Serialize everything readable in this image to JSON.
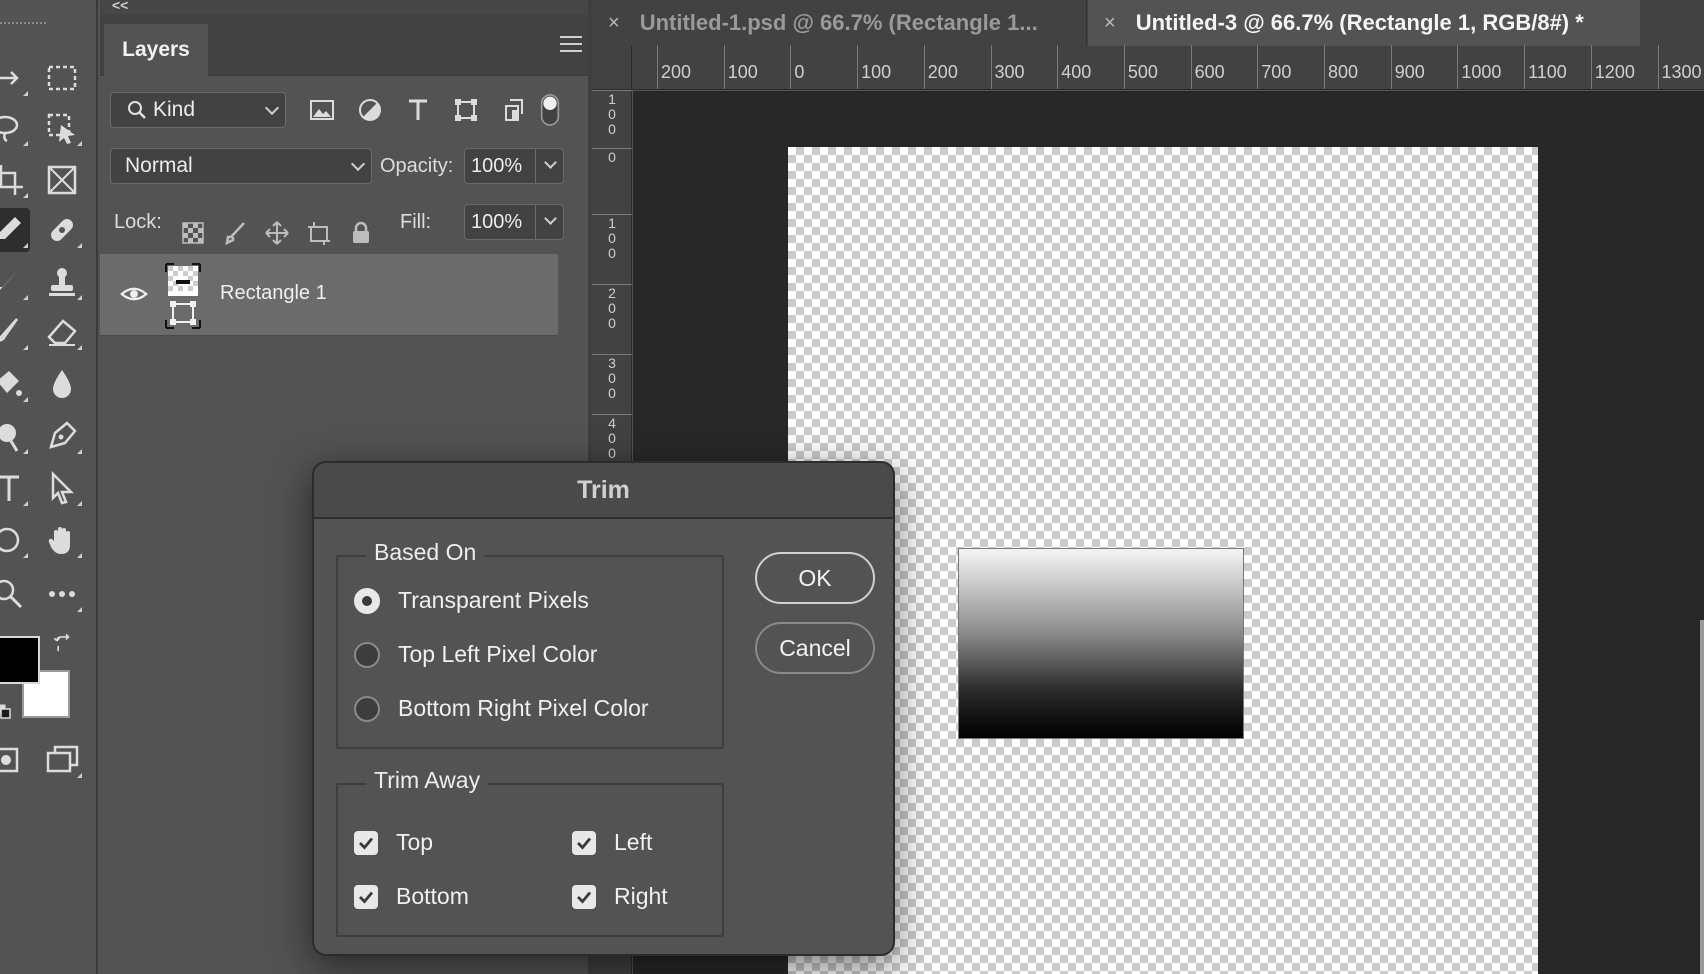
{
  "toolbar": {
    "collapse_glyph": "<<",
    "tools": [
      {
        "name": "move-tool",
        "icon": "move-icon"
      },
      {
        "name": "marquee-tool",
        "icon": "rectangular-marquee-icon"
      },
      {
        "name": "lasso-tool",
        "icon": "lasso-icon"
      },
      {
        "name": "object-selection-tool",
        "icon": "object-selection-icon"
      },
      {
        "name": "crop-tool",
        "icon": "crop-icon"
      },
      {
        "name": "frame-tool",
        "icon": "frame-icon"
      },
      {
        "name": "eyedropper-tool",
        "icon": "eyedropper-icon"
      },
      {
        "name": "healing-brush-tool",
        "icon": "bandage-icon"
      },
      {
        "name": "brush-tool",
        "icon": "brush-icon"
      },
      {
        "name": "clone-stamp-tool",
        "icon": "stamp-icon"
      },
      {
        "name": "history-brush-tool",
        "icon": "history-brush-icon"
      },
      {
        "name": "eraser-tool",
        "icon": "eraser-icon"
      },
      {
        "name": "paint-bucket-tool",
        "icon": "bucket-icon"
      },
      {
        "name": "blur-tool",
        "icon": "drop-icon"
      },
      {
        "name": "dodge-tool",
        "icon": "dodge-icon"
      },
      {
        "name": "pen-tool",
        "icon": "pen-icon"
      },
      {
        "name": "type-tool",
        "icon": "type-icon"
      },
      {
        "name": "path-selection-tool",
        "icon": "arrow-icon"
      },
      {
        "name": "shape-tool",
        "icon": "ellipse-icon"
      },
      {
        "name": "hand-tool",
        "icon": "hand-icon"
      },
      {
        "name": "zoom-tool",
        "icon": "zoom-icon"
      },
      {
        "name": "more-tools",
        "icon": "more-icon"
      }
    ],
    "foreground_color": "#000000",
    "background_color": "#ffffff"
  },
  "layers_panel": {
    "tab_label": "Layers",
    "filter_kind": "Kind",
    "blend_mode": "Normal",
    "opacity_label": "Opacity:",
    "opacity_value": "100%",
    "lock_label": "Lock:",
    "fill_label": "Fill:",
    "fill_value": "100%",
    "layers": [
      {
        "name": "Rectangle 1",
        "visible": true,
        "selected": true
      }
    ]
  },
  "documents": {
    "tabs": [
      {
        "label": "Untitled-1.psd @ 66.7% (Rectangle 1...",
        "active": false
      },
      {
        "label": "Untitled-3 @ 66.7% (Rectangle 1, RGB/8#) *",
        "active": true
      }
    ],
    "close_glyph": "×"
  },
  "rulers": {
    "horizontal": [
      "200",
      "100",
      "0",
      "100",
      "200",
      "300",
      "400",
      "500",
      "600",
      "700",
      "800",
      "900",
      "1000",
      "1100",
      "1200",
      "1300"
    ],
    "vertical": [
      "100",
      "0",
      "100",
      "200",
      "300",
      "400"
    ]
  },
  "trim_dialog": {
    "title": "Trim",
    "based_on_label": "Based On",
    "options": [
      {
        "label": "Transparent Pixels",
        "selected": true
      },
      {
        "label": "Top Left Pixel Color",
        "selected": false
      },
      {
        "label": "Bottom Right Pixel Color",
        "selected": false
      }
    ],
    "trim_away_label": "Trim Away",
    "trim_away": {
      "top": {
        "label": "Top",
        "checked": true
      },
      "left": {
        "label": "Left",
        "checked": true
      },
      "bottom": {
        "label": "Bottom",
        "checked": true
      },
      "right": {
        "label": "Right",
        "checked": true
      }
    },
    "ok_label": "OK",
    "cancel_label": "Cancel"
  },
  "colors": {
    "panel_bg": "#535353",
    "canvas_bg": "#282828",
    "header_bg": "#424242"
  }
}
